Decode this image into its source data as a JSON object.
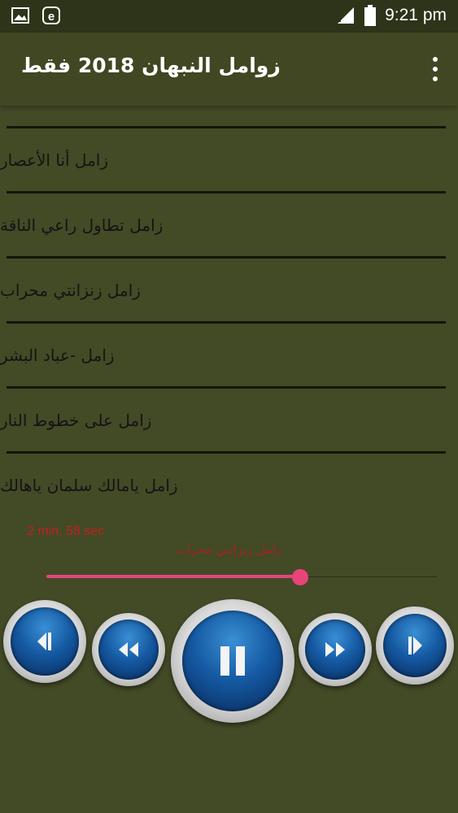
{
  "status_bar": {
    "time": "9:21 pm",
    "left_icons": [
      "image-icon",
      "e-badge-icon"
    ],
    "right_icons": [
      "signal-icon",
      "battery-icon"
    ]
  },
  "app_bar": {
    "title": "زوامل النبهان 2018 فقط",
    "menu_icon": "overflow-menu-icon"
  },
  "list": {
    "items": [
      {
        "label": "زامل أنا الأعصار"
      },
      {
        "label": "زامل تطاول راعي الناقة"
      },
      {
        "label": "زامل زنزانتي محراب"
      },
      {
        "label": "زامل -عباد البشر"
      },
      {
        "label": "زامل على خطوط النار"
      },
      {
        "label": "زامل يامالك سلمان ياهالك"
      }
    ]
  },
  "player": {
    "time_text": "2 min, 58 sec",
    "now_playing": "زامل زنزانتي محراب",
    "progress": 0.65,
    "colors": {
      "accent": "#e4457a",
      "time": "#c42020",
      "background": "#434a26"
    },
    "controls": [
      {
        "name": "skip-previous-button",
        "icon": "skip-previous-icon"
      },
      {
        "name": "rewind-button",
        "icon": "rewind-icon"
      },
      {
        "name": "pause-button",
        "icon": "pause-icon"
      },
      {
        "name": "fast-forward-button",
        "icon": "fast-forward-icon"
      },
      {
        "name": "skip-next-button",
        "icon": "skip-next-icon"
      }
    ]
  }
}
